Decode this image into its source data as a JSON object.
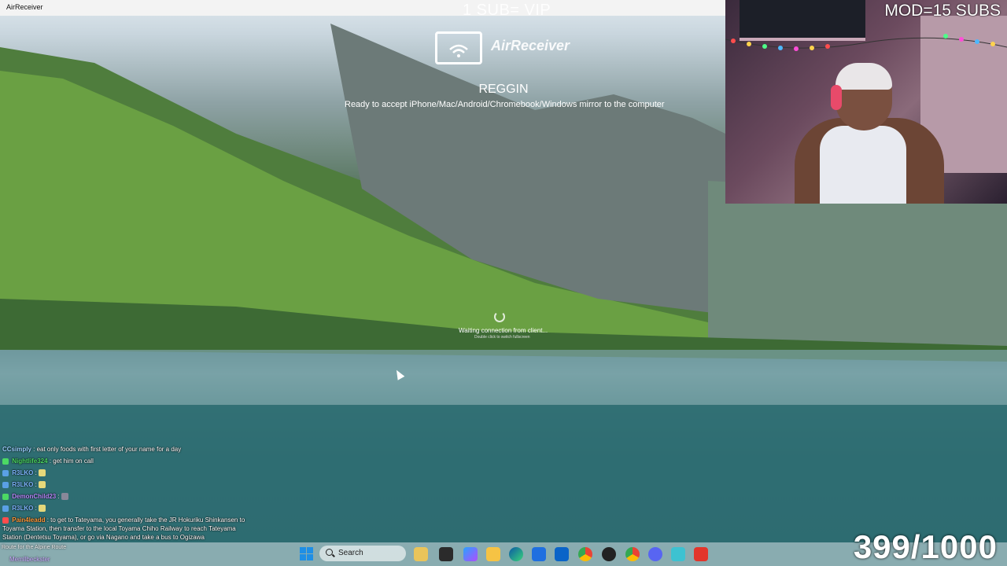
{
  "window": {
    "title": "AirReceiver"
  },
  "overlay": {
    "top_text": "1 SUB= VIP",
    "mod_text": "MOD=15 SUBS",
    "counter": "399/1000"
  },
  "receiver": {
    "brand": "AirReceiver",
    "device_name": "REGGIN",
    "ready_text": "Ready to accept iPhone/Mac/Android/Chromebook/Windows mirror to the computer",
    "waiting_text": "Waiting connection from client...",
    "waiting_sub": "Double click to switch fullscreen"
  },
  "chat": {
    "messages": [
      {
        "user": "CCsimply",
        "color": "#9ad0ff",
        "text": ": eat only foods with first letter of your name for a day"
      },
      {
        "user": "Nightlife324",
        "color": "#4cd964",
        "text": ": get him on call"
      },
      {
        "user": "R3LKO",
        "color": "#7eb6ff",
        "text": ":"
      },
      {
        "user": "R3LKO",
        "color": "#7eb6ff",
        "text": ":"
      },
      {
        "user": "DemonChild23",
        "color": "#b98cff",
        "text": ":"
      },
      {
        "user": "R3LKO",
        "color": "#7eb6ff",
        "text": ":"
      },
      {
        "user": "Pain4leadd",
        "color": "#ff9a3c",
        "text": ": to get to Tateyama, you generally take the JR Hokuriku Shinkansen to Toyama Station, then transfer to the local Toyama Chiho Railway to reach Tateyama Station (Dentetsu Toyama), or go via Nagano and take a bus to Ogizawa"
      }
    ],
    "footer_line": "Route for the Alpine Route",
    "footer_user": "Memllbeckster"
  },
  "taskbar": {
    "search_placeholder": "Search",
    "icons": [
      "windows-start-icon",
      "search-icon",
      "widgets-icon",
      "task-view-icon",
      "copilot-icon",
      "file-explorer-icon",
      "edge-icon",
      "store-icon",
      "outlook-icon",
      "chrome-icon",
      "chrome-icon-2",
      "chrome-icon-3",
      "discord-icon",
      "notepad-icon",
      "recorder-icon"
    ]
  },
  "colors": {
    "taskbar": "#d7e1e6",
    "accent": "#1f8fe5"
  }
}
